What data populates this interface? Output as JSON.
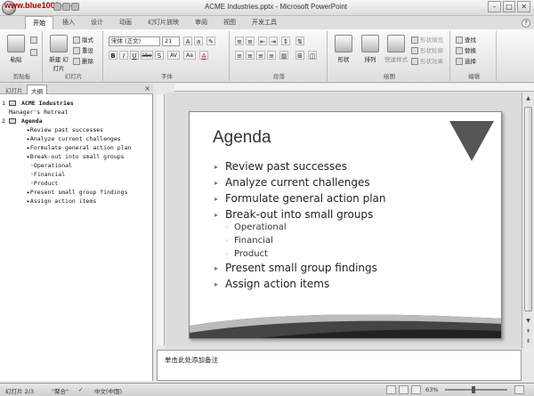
{
  "watermark": "www.blue1000.com",
  "window": {
    "title": "ACME Industries.pptx - Microsoft PowerPoint",
    "minimize": "–",
    "maximize": "□",
    "close": "✕"
  },
  "ribbon": {
    "tabs": [
      "开始",
      "插入",
      "设计",
      "动画",
      "幻灯片放映",
      "审阅",
      "视图",
      "开发工具"
    ],
    "active_tab": "开始",
    "clipboard": {
      "paste": "粘贴",
      "cut": "剪切",
      "copy": "复制",
      "label": "剪贴板"
    },
    "slides": {
      "new_slide": "新建\n幻灯片",
      "layout": "版式",
      "reset": "重设",
      "delete": "删除",
      "label": "幻灯片"
    },
    "font": {
      "font_name": "宋体 (正文)",
      "font_size": "21",
      "bold": "B",
      "italic": "I",
      "underline": "U",
      "strike": "abe",
      "shadow": "S",
      "spacing": "AV",
      "case": "Aa",
      "color": "A",
      "label": "字体"
    },
    "paragraph": {
      "label": "段落"
    },
    "drawing": {
      "shape": "形状",
      "arrange": "排列",
      "quick_styles": "快速样式",
      "fill": "形状填充",
      "outline": "形状轮廓",
      "effects": "形状效果",
      "label": "绘图"
    },
    "editing": {
      "find": "查找",
      "replace": "替换",
      "select": "选择",
      "label": "编辑"
    }
  },
  "leftpane": {
    "tab_slides": "幻灯片",
    "tab_outline": "大纲",
    "close": "×",
    "outline": [
      {
        "num": "1",
        "text": "ACME Industries",
        "bold": true,
        "level": 0
      },
      {
        "num": "",
        "text": "Manager's Retreat",
        "bold": false,
        "level": 1
      },
      {
        "num": "2",
        "text": "Agenda",
        "bold": true,
        "level": 0
      },
      {
        "num": "",
        "text": "▸Review past successes",
        "level": 2
      },
      {
        "num": "",
        "text": "▸Analyze current challenges",
        "level": 2
      },
      {
        "num": "",
        "text": "▸Formulate general action plan",
        "level": 2
      },
      {
        "num": "",
        "text": "▸Break-out into small groups",
        "level": 2
      },
      {
        "num": "",
        "text": "◦Operational",
        "level": 3
      },
      {
        "num": "",
        "text": "◦Financial",
        "level": 3
      },
      {
        "num": "",
        "text": "◦Product",
        "level": 3
      },
      {
        "num": "",
        "text": "▸Present small group findings",
        "level": 2
      },
      {
        "num": "",
        "text": "▸Assign action items",
        "level": 2
      }
    ]
  },
  "slide": {
    "title": "Agenda",
    "bullets": [
      "Review past successes",
      "Analyze current challenges",
      "Formulate general action plan",
      "Break-out into small groups"
    ],
    "subbullets": [
      "Operational",
      "Financial",
      "Product"
    ],
    "bullets_after": [
      "Present small group findings",
      "Assign action items"
    ]
  },
  "notes": {
    "placeholder": "单击此处添加备注"
  },
  "status": {
    "slide_counter": "幻灯片 2/3",
    "theme": "\"聚合\"",
    "language": "中文(中国)",
    "zoom": "63%"
  }
}
